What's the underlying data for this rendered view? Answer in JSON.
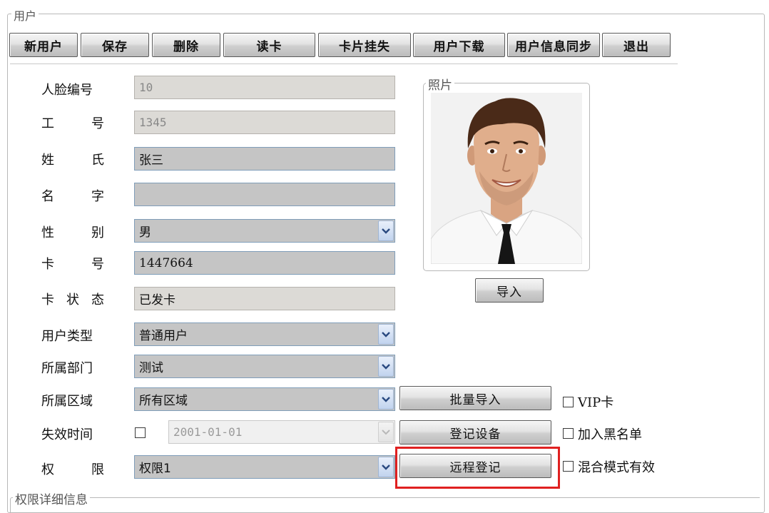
{
  "group": {
    "title": "用户"
  },
  "toolbar": [
    {
      "id": "new-user",
      "label": "新用户"
    },
    {
      "id": "save",
      "label": "保存"
    },
    {
      "id": "delete",
      "label": "删除"
    },
    {
      "id": "read-card",
      "label": "读卡"
    },
    {
      "id": "report-card-lost",
      "label": "卡片挂失"
    },
    {
      "id": "download-user",
      "label": "用户下载"
    },
    {
      "id": "sync-user-info",
      "label": "用户信息同步"
    },
    {
      "id": "exit",
      "label": "退出"
    }
  ],
  "form": {
    "face_id": {
      "label": "人脸编号",
      "value": "10"
    },
    "employee_no": {
      "label_a": "工",
      "label_b": "号",
      "value": "1345"
    },
    "surname": {
      "label_a": "姓",
      "label_b": "氏",
      "value": "张三"
    },
    "given_name": {
      "label_a": "名",
      "label_b": "字",
      "value": ""
    },
    "gender": {
      "label_a": "性",
      "label_b": "别",
      "value": "男"
    },
    "card_no": {
      "label_a": "卡",
      "label_b": "号",
      "value": "1447664"
    },
    "card_status": {
      "label_a": "卡",
      "label_m": "状",
      "label_b": "态",
      "value": "已发卡"
    },
    "user_type": {
      "label": "用户类型",
      "value": "普通用户"
    },
    "department": {
      "label": "所属部门",
      "value": "测试"
    },
    "area": {
      "label": "所属区域",
      "value": "所有区域"
    },
    "expire_time": {
      "label": "失效时间",
      "value": "2001-01-01",
      "checked": false
    },
    "permission": {
      "label_a": "权",
      "label_b": "限",
      "value": "权限1"
    }
  },
  "photo": {
    "title": "照片",
    "import_label": "导入"
  },
  "side_buttons": {
    "batch_import": "批量导入",
    "register_device": "登记设备",
    "remote_register": "远程登记"
  },
  "options": {
    "vip": {
      "label": "VIP卡",
      "checked": false
    },
    "blacklist": {
      "label": "加入黑名单",
      "checked": false
    },
    "mixed_mode": {
      "label": "混合模式有效",
      "checked": false
    }
  },
  "permission_details": {
    "title": "权限详细信息"
  },
  "colors": {
    "highlight": "#e02020",
    "field_bg": "#c5c5c5",
    "readonly_bg": "#dcdad6"
  }
}
